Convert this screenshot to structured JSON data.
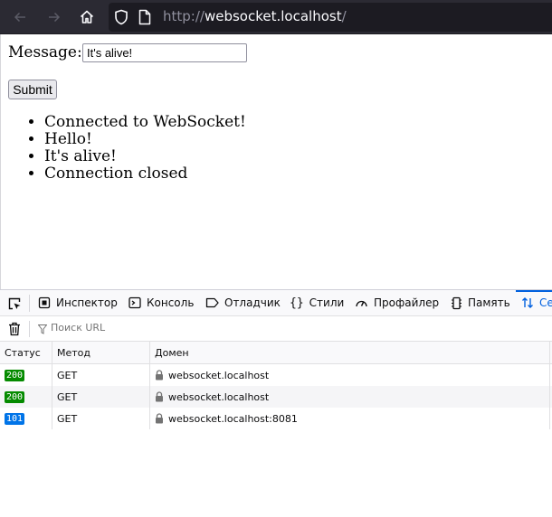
{
  "browser": {
    "url_scheme": "http://",
    "url_host": "websocket.localhost",
    "url_path": "/"
  },
  "page": {
    "message_label": "Message:",
    "message_value": "It's alive!",
    "submit_label": "Submit",
    "messages": [
      "Connected to WebSocket!",
      "Hello!",
      "It's alive!",
      "Connection closed"
    ]
  },
  "devtools": {
    "tabs": [
      {
        "label": "Инспектор",
        "icon": "inspector-icon"
      },
      {
        "label": "Консоль",
        "icon": "console-icon"
      },
      {
        "label": "Отладчик",
        "icon": "debugger-icon"
      },
      {
        "label": "Стили",
        "icon": "style-editor-icon"
      },
      {
        "label": "Профайлер",
        "icon": "profiler-icon"
      },
      {
        "label": "Память",
        "icon": "memory-icon"
      },
      {
        "label": "Се",
        "icon": "network-icon"
      }
    ],
    "filter_placeholder": "Поиск URL",
    "columns": {
      "status": "Статус",
      "method": "Метод",
      "domain": "Домен"
    },
    "requests": [
      {
        "status": "200",
        "status_color": "#058b00",
        "method": "GET",
        "domain": "websocket.localhost"
      },
      {
        "status": "200",
        "status_color": "#058b00",
        "method": "GET",
        "domain": "websocket.localhost"
      },
      {
        "status": "101",
        "status_color": "#0074e8",
        "method": "GET",
        "domain": "websocket.localhost:8081"
      }
    ]
  }
}
